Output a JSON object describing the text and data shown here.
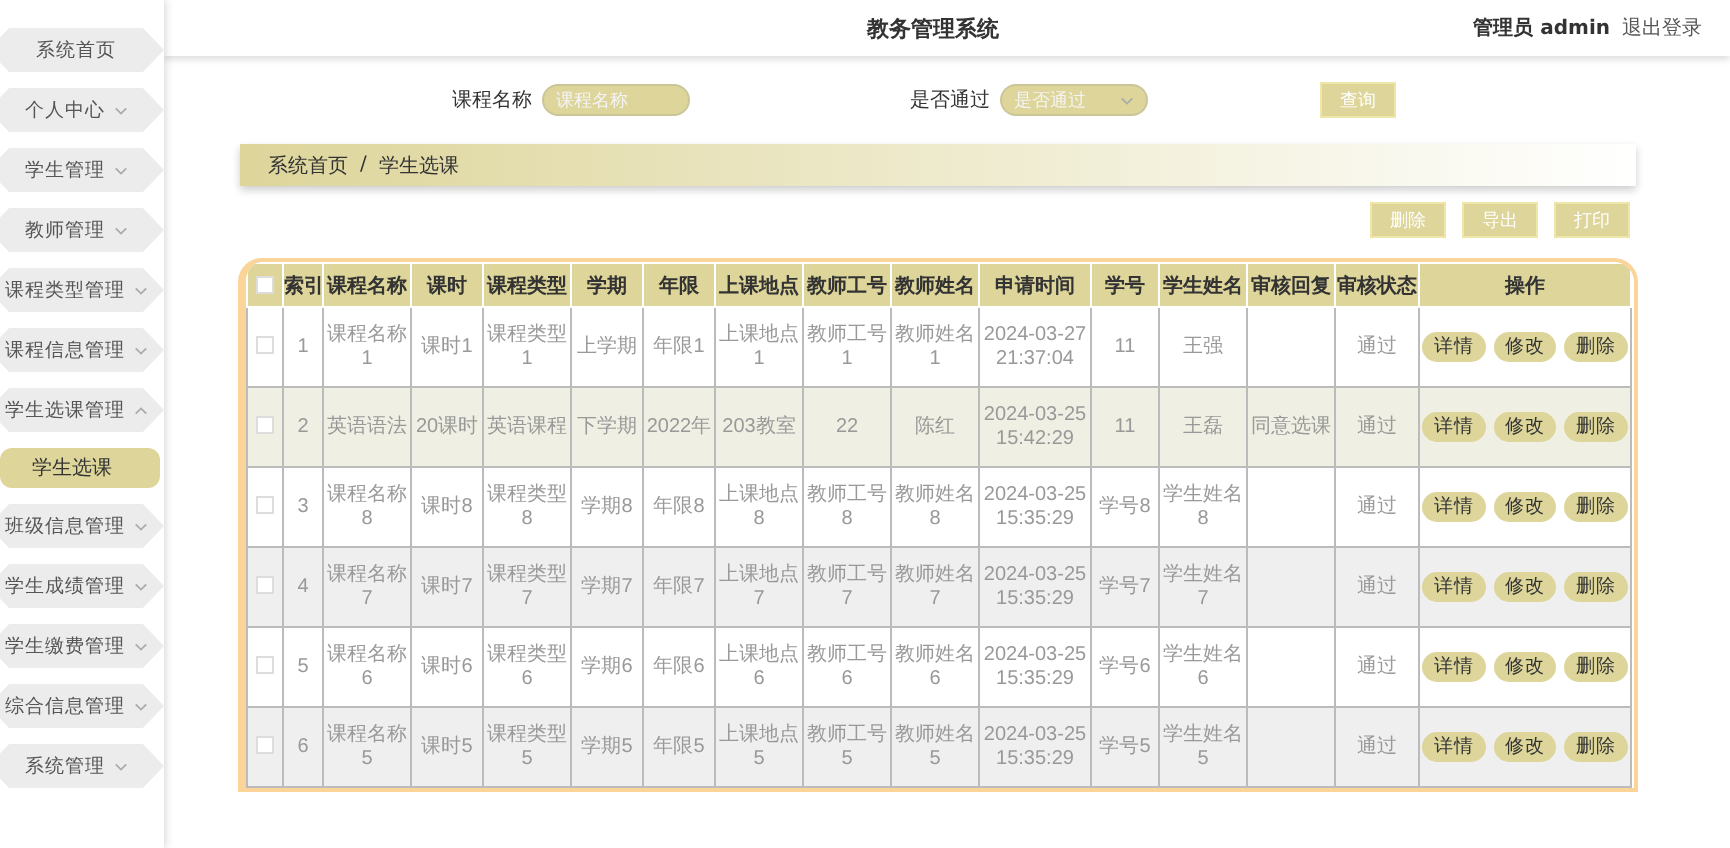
{
  "header": {
    "title": "教务管理系统",
    "user": "管理员 admin",
    "logout": "退出登录"
  },
  "sidebar": {
    "items": [
      {
        "label": "系统首页",
        "kind": "link",
        "selected": false
      },
      {
        "label": "个人中心",
        "kind": "menu",
        "expanded": false,
        "selected": false
      },
      {
        "label": "学生管理",
        "kind": "menu",
        "expanded": false,
        "selected": false
      },
      {
        "label": "教师管理",
        "kind": "menu",
        "expanded": false,
        "selected": false
      },
      {
        "label": "课程类型管理",
        "kind": "menu",
        "expanded": false,
        "selected": false
      },
      {
        "label": "课程信息管理",
        "kind": "menu",
        "expanded": false,
        "selected": false
      },
      {
        "label": "学生选课管理",
        "kind": "menu",
        "expanded": true,
        "selected": false,
        "children": [
          {
            "label": "学生选课",
            "selected": true
          }
        ]
      },
      {
        "label": "班级信息管理",
        "kind": "menu",
        "expanded": false,
        "selected": false
      },
      {
        "label": "学生成绩管理",
        "kind": "menu",
        "expanded": false,
        "selected": false
      },
      {
        "label": "学生缴费管理",
        "kind": "menu",
        "expanded": false,
        "selected": false
      },
      {
        "label": "综合信息管理",
        "kind": "menu",
        "expanded": false,
        "selected": false
      },
      {
        "label": "系统管理",
        "kind": "menu",
        "expanded": false,
        "selected": false
      }
    ]
  },
  "search": {
    "fields": [
      {
        "label": "课程名称",
        "placeholder": "课程名称",
        "kind": "input"
      },
      {
        "label": "是否通过",
        "placeholder": "是否通过",
        "kind": "select"
      }
    ],
    "button": "查询"
  },
  "breadcrumb": {
    "items": [
      "系统首页",
      "学生选课"
    ],
    "separator": "/"
  },
  "toolbar": [
    "删除",
    "导出",
    "打印"
  ],
  "table": {
    "all_checked": false,
    "columns": [
      "索引",
      "课程名称",
      "课时",
      "课程类型",
      "学期",
      "年限",
      "上课地点",
      "教师工号",
      "教师姓名",
      "申请时间",
      "学号",
      "学生姓名",
      "审核回复",
      "审核状态",
      "操作"
    ],
    "rows": [
      {
        "checked": false,
        "hovered": false,
        "cells": [
          "1",
          "课程名称1",
          "课时1",
          "课程类型1",
          "上学期",
          "年限1",
          "上课地点1",
          "教师工号1",
          "教师姓名1",
          "2024-03-27 21:37:04",
          "11",
          "王强",
          null,
          "通过"
        ],
        "actions": [
          "详情",
          "修改",
          "删除"
        ]
      },
      {
        "checked": false,
        "hovered": true,
        "cells": [
          "2",
          "英语语法",
          "20课时",
          "英语课程",
          "下学期",
          "2022年",
          "203教室",
          "22",
          "陈红",
          "2024-03-25 15:42:29",
          "11",
          "王磊",
          "同意选课",
          "通过"
        ],
        "actions": [
          "详情",
          "修改",
          "删除"
        ]
      },
      {
        "checked": false,
        "hovered": false,
        "cells": [
          "3",
          "课程名称8",
          "课时8",
          "课程类型8",
          "学期8",
          "年限8",
          "上课地点8",
          "教师工号8",
          "教师姓名8",
          "2024-03-25 15:35:29",
          "学号8",
          "学生姓名8",
          null,
          "通过"
        ],
        "actions": [
          "详情",
          "修改",
          "删除"
        ]
      },
      {
        "checked": false,
        "hovered": false,
        "cells": [
          "4",
          "课程名称7",
          "课时7",
          "课程类型7",
          "学期7",
          "年限7",
          "上课地点7",
          "教师工号7",
          "教师姓名7",
          "2024-03-25 15:35:29",
          "学号7",
          "学生姓名7",
          null,
          "通过"
        ],
        "actions": [
          "详情",
          "修改",
          "删除"
        ]
      },
      {
        "checked": false,
        "hovered": false,
        "cells": [
          "5",
          "课程名称6",
          "课时6",
          "课程类型6",
          "学期6",
          "年限6",
          "上课地点6",
          "教师工号6",
          "教师姓名6",
          "2024-03-25 15:35:29",
          "学号6",
          "学生姓名6",
          null,
          "通过"
        ],
        "actions": [
          "详情",
          "修改",
          "删除"
        ]
      },
      {
        "checked": false,
        "hovered": false,
        "cells": [
          "6",
          "课程名称5",
          "课时5",
          "课程类型5",
          "学期5",
          "年限5",
          "上课地点5",
          "教师工号5",
          "教师姓名5",
          "2024-03-25 15:35:29",
          "学号5",
          "学生姓名5",
          null,
          "通过"
        ],
        "actions": [
          "详情",
          "修改",
          "删除"
        ]
      }
    ]
  }
}
